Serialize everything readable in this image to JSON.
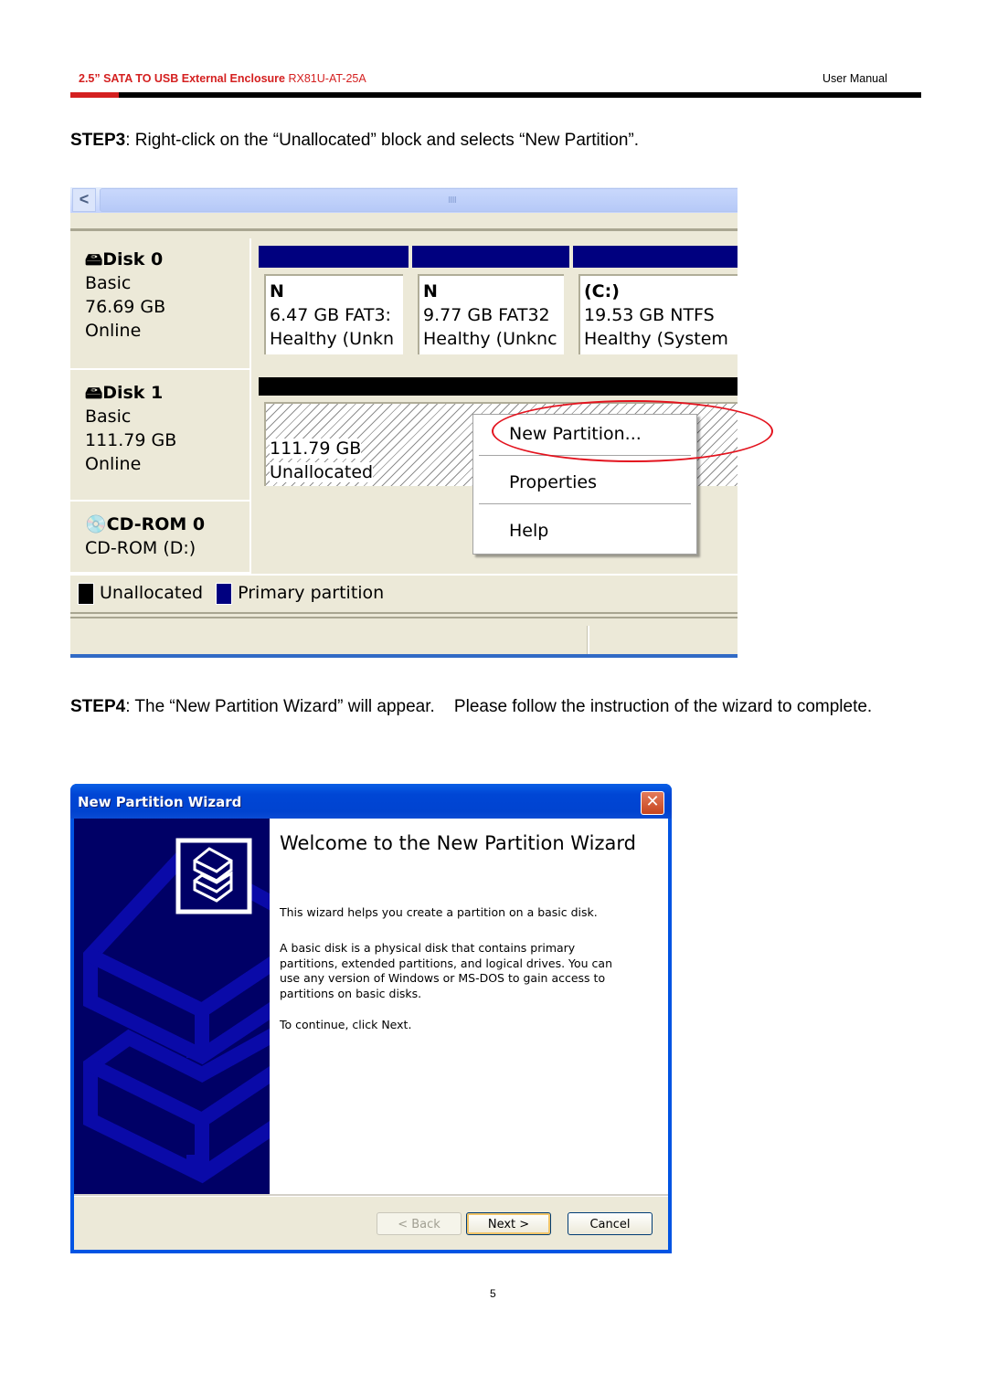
{
  "header": {
    "title_bold": "2.5”  SATA  TO  USB  External  Enclosure",
    "model": "RX81U-AT-25A",
    "right": "User  Manual",
    "accent_color": "#d42020"
  },
  "step3": {
    "label": "STEP3",
    "text": ": Right-click on the “Unallocated” block and selects “New Partition”."
  },
  "disk_management": {
    "scrollbar": {
      "left_arrow": "<",
      "grip": "IIIII"
    },
    "disks": [
      {
        "icon": "hard-disk-icon",
        "title": "Disk 0",
        "type": "Basic",
        "size": "76.69 GB",
        "status": "Online",
        "partitions": [
          {
            "name": "N",
            "size_fs": "6.47 GB FAT3:",
            "health": "Healthy (Unkn"
          },
          {
            "name": "N",
            "size_fs": "9.77 GB FAT32",
            "health": "Healthy (Unknc"
          },
          {
            "name": " (C:)",
            "size_fs": "19.53 GB NTFS",
            "health": "Healthy (System"
          }
        ]
      },
      {
        "icon": "hard-disk-icon",
        "title": "Disk 1",
        "type": "Basic",
        "size": "111.79 GB",
        "status": "Online",
        "unallocated": {
          "size": "111.79 GB",
          "label": "Unallocated"
        }
      },
      {
        "icon": "cd-rom-icon",
        "title": "CD-ROM 0",
        "drive": "CD-ROM (D:)"
      }
    ],
    "context_menu": [
      "New Partition...",
      "Properties",
      "Help"
    ],
    "legend": [
      {
        "label": "Unallocated",
        "color": "#000000"
      },
      {
        "label": "Primary partition",
        "color": "#00007f"
      }
    ]
  },
  "step4": {
    "label": "STEP4",
    "text": ": The “New Partition Wizard” will appear.    Please follow the instruction of the wizard to complete."
  },
  "wizard": {
    "title": "New Partition Wizard",
    "close": "✕",
    "heading": "Welcome to the New Partition Wizard",
    "p1": "This wizard helps you create a partition on a basic disk.",
    "p2": "A basic disk is a physical disk that contains primary partitions, extended partitions, and logical drives. You can use any version of Windows or MS-DOS to gain access to partitions on basic disks.",
    "p3": "To continue, click Next.",
    "buttons": {
      "back": "< Back",
      "next": "Next >",
      "cancel": "Cancel"
    }
  },
  "page_number": "5"
}
